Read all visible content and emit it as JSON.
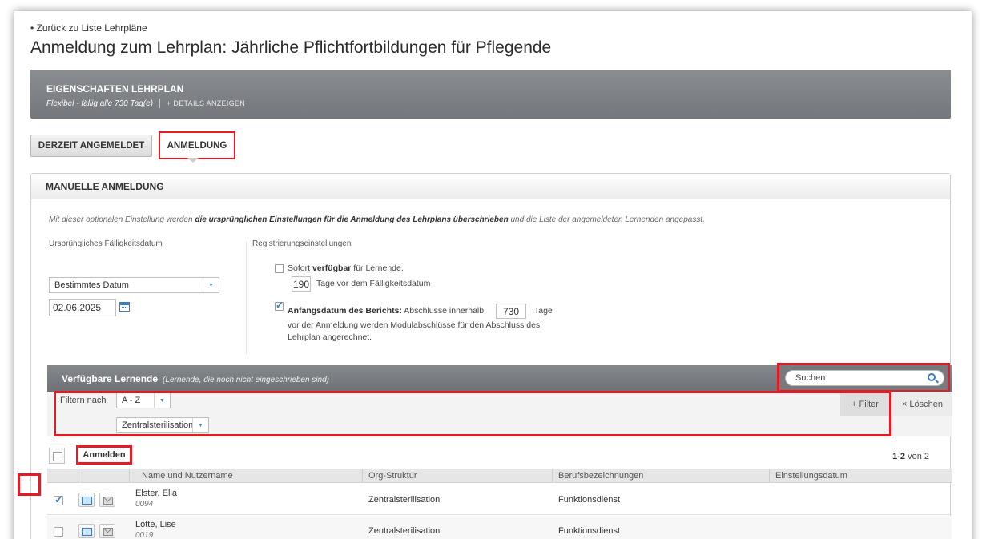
{
  "back_link": "Zurück zu Liste Lehrpläne",
  "page_title": "Anmeldung zum Lehrplan: Jährliche Pflichtfortbildungen für Pflegende",
  "properties": {
    "title": "EIGENSCHAFTEN LEHRPLAN",
    "flex_text": "Flexibel - fällig alle 730 Tag(e)",
    "details_link": "+ DETAILS ANZEIGEN"
  },
  "tabs": {
    "current": "DERZEIT ANGEMELDET",
    "enroll": "ANMELDUNG"
  },
  "manual": {
    "header": "MANUELLE ANMELDUNG",
    "info_prefix": "Mit dieser optionalen Einstellung werden ",
    "info_bold": "die ursprünglichen Einstellungen für die Anmeldung des Lehrplans überschrieben",
    "info_suffix": " und die Liste der angemeldeten Lernenden angepasst.",
    "due_label": "Ursprüngliches Fälligkeitsdatum",
    "due_select": "Bestimmtes Datum",
    "due_date": "02.06.2025",
    "reg_label": "Registrierungseinstellungen",
    "avail_prefix": "Sofort ",
    "avail_bold": "verfügbar",
    "avail_suffix": " für Lernende.",
    "avail_days": "190",
    "avail_days_text": "Tage vor dem Fälligkeitsdatum",
    "report_bold": "Anfangsdatum des Berichts:",
    "report_text": " Abschlüsse innerhalb",
    "report_days": "730",
    "report_days_unit": "Tage",
    "report_line2": "vor der Anmeldung werden Modulabschlüsse für den Abschluss des",
    "report_line3": "Lehrplan angerechnet."
  },
  "learners": {
    "title": "Verfügbare Lernende",
    "subtitle": "(Lernende, die noch nicht eingeschrieben sind)",
    "search_placeholder": "Suchen",
    "filter_label": "Filtern nach",
    "filter_sort": "A - Z",
    "filter_dept": "Zentralsterilisation",
    "filter_button": "+ Filter",
    "clear_button": "× Löschen",
    "enroll_button": "Anmelden",
    "pager_range": "1-2",
    "pager_of": "von 2",
    "columns": [
      "Name und Nutzername",
      "Org-Struktur",
      "Berufsbezeichnungen",
      "Einstellungsdatum"
    ],
    "rows": [
      {
        "name": "Elster, Ella",
        "id": "0094",
        "org": "Zentralsterilisation",
        "job": "Funktionsdienst",
        "checked": true
      },
      {
        "name": "Lotte, Lise",
        "id": "0019",
        "org": "Zentralsterilisation",
        "job": "Funktionsdienst",
        "checked": false
      }
    ]
  },
  "colors": {
    "highlight": "#e21b24",
    "accent": "#3b7bc0",
    "header_gray": "#7b7e83"
  }
}
